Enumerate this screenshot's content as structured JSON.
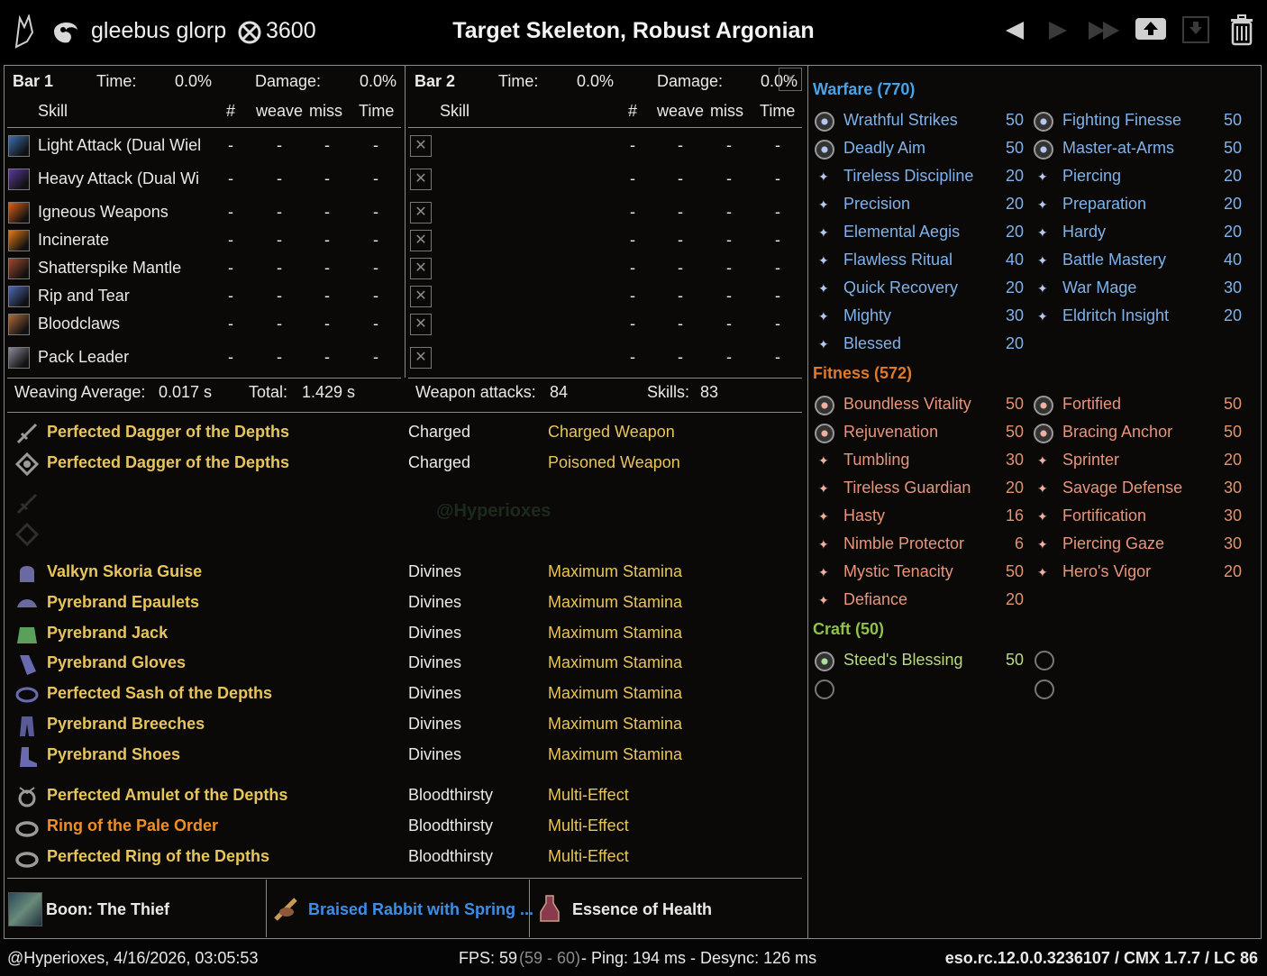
{
  "header": {
    "player_name": "gleebus glorp",
    "cp_total": "3600",
    "title": "Target Skeleton, Robust Argonian",
    "icons": [
      "class-logo-icon",
      "player-icon",
      "champion-points-icon",
      "previous-icon",
      "next-icon",
      "last-icon",
      "upload-icon",
      "save-icon",
      "delete-icon"
    ]
  },
  "bar1": {
    "label": "Bar 1",
    "time_label": "Time:",
    "time_value": "0.0%",
    "damage_label": "Damage:",
    "damage_value": "0.0%",
    "col_skill": "Skill",
    "col_count": "#",
    "col_weave": "weave",
    "col_miss": "miss",
    "col_time": "Time",
    "skills": [
      {
        "name": "Light Attack (Dual Wiel",
        "count": "-",
        "weave": "-",
        "miss": "-",
        "time": "-",
        "color": "#3a6fb0"
      },
      {
        "name": "Heavy Attack (Dual Wi",
        "count": "-",
        "weave": "-",
        "miss": "-",
        "time": "-",
        "color": "#5a3a9a"
      },
      {
        "name": "Igneous Weapons",
        "count": "-",
        "weave": "-",
        "miss": "-",
        "time": "-",
        "color": "#d8601a"
      },
      {
        "name": "Incinerate",
        "count": "-",
        "weave": "-",
        "miss": "-",
        "time": "-",
        "color": "#e07a18"
      },
      {
        "name": "Shatterspike Mantle",
        "count": "-",
        "weave": "-",
        "miss": "-",
        "time": "-",
        "color": "#a04a2a"
      },
      {
        "name": "Rip and Tear",
        "count": "-",
        "weave": "-",
        "miss": "-",
        "time": "-",
        "color": "#4a6ab0"
      },
      {
        "name": "Bloodclaws",
        "count": "-",
        "weave": "-",
        "miss": "-",
        "time": "-",
        "color": "#b06a3a"
      },
      {
        "name": "Pack Leader",
        "count": "-",
        "weave": "-",
        "miss": "-",
        "time": "-",
        "color": "#8a8a9a"
      }
    ]
  },
  "bar2": {
    "label": "Bar 2",
    "time_label": "Time:",
    "time_value": "0.0%",
    "damage_label": "Damage:",
    "damage_value": "0.0%",
    "col_skill": "Skill",
    "col_count": "#",
    "col_weave": "weave",
    "col_miss": "miss",
    "col_time": "Time",
    "empty_marker": "✕",
    "rows": [
      {
        "count": "-",
        "weave": "-",
        "miss": "-",
        "time": "-"
      },
      {
        "count": "-",
        "weave": "-",
        "miss": "-",
        "time": "-"
      },
      {
        "count": "-",
        "weave": "-",
        "miss": "-",
        "time": "-"
      },
      {
        "count": "-",
        "weave": "-",
        "miss": "-",
        "time": "-"
      },
      {
        "count": "-",
        "weave": "-",
        "miss": "-",
        "time": "-"
      },
      {
        "count": "-",
        "weave": "-",
        "miss": "-",
        "time": "-"
      },
      {
        "count": "-",
        "weave": "-",
        "miss": "-",
        "time": "-"
      },
      {
        "count": "-",
        "weave": "-",
        "miss": "-",
        "time": "-"
      }
    ]
  },
  "summary": {
    "weaving_label": "Weaving Average:",
    "weaving_value": "0.017 s",
    "total_label": "Total:",
    "total_value": "1.429 s",
    "weapon_attacks_label": "Weapon attacks:",
    "weapon_attacks_value": "84",
    "skills_label": "Skills:",
    "skills_value": "83"
  },
  "gear": {
    "weapons": [
      {
        "name": "Perfected Dagger of the Depths",
        "trait": "Charged",
        "enchant": "Charged Weapon",
        "icon": "dagger-icon"
      },
      {
        "name": "Perfected Dagger of the Depths",
        "trait": "Charged",
        "enchant": "Poisoned Weapon",
        "icon": "dagger-icon"
      }
    ],
    "armor": [
      {
        "name": "Valkyn Skoria Guise",
        "trait": "Divines",
        "enchant": "Maximum Stamina",
        "icon": "helmet-icon"
      },
      {
        "name": "Pyrebrand Epaulets",
        "trait": "Divines",
        "enchant": "Maximum Stamina",
        "icon": "shoulders-icon"
      },
      {
        "name": "Pyrebrand Jack",
        "trait": "Divines",
        "enchant": "Maximum Stamina",
        "icon": "chest-icon"
      },
      {
        "name": "Pyrebrand Gloves",
        "trait": "Divines",
        "enchant": "Maximum Stamina",
        "icon": "gloves-icon"
      },
      {
        "name": "Perfected Sash of the Depths",
        "trait": "Divines",
        "enchant": "Maximum Stamina",
        "icon": "belt-icon"
      },
      {
        "name": "Pyrebrand Breeches",
        "trait": "Divines",
        "enchant": "Maximum Stamina",
        "icon": "legs-icon"
      },
      {
        "name": "Pyrebrand Shoes",
        "trait": "Divines",
        "enchant": "Maximum Stamina",
        "icon": "boots-icon"
      }
    ],
    "jewelry": [
      {
        "name": "Perfected Amulet of the Depths",
        "trait": "Bloodthirsty",
        "enchant": "Multi-Effect",
        "icon": "amulet-icon",
        "quality": "gold"
      },
      {
        "name": "Ring of the Pale Order",
        "trait": "Bloodthirsty",
        "enchant": "Multi-Effect",
        "icon": "ring-icon",
        "quality": "orange"
      },
      {
        "name": "Perfected Ring of the Depths",
        "trait": "Bloodthirsty",
        "enchant": "Multi-Effect",
        "icon": "ring-icon",
        "quality": "gold"
      }
    ],
    "watermark": "@Hyperioxes"
  },
  "buffs": {
    "mundus": "Boon: The Thief",
    "food": "Braised Rabbit with Spring ...",
    "drink": "Essence of Health"
  },
  "cp": {
    "warfare": {
      "title": "Warfare (770)",
      "left": [
        {
          "name": "Wrathful Strikes",
          "value": "50",
          "slotted": true
        },
        {
          "name": "Deadly Aim",
          "value": "50",
          "slotted": true
        },
        {
          "name": "Tireless Discipline",
          "value": "20",
          "slotted": false
        },
        {
          "name": "Precision",
          "value": "20",
          "slotted": false
        },
        {
          "name": "Elemental Aegis",
          "value": "20",
          "slotted": false
        },
        {
          "name": "Flawless Ritual",
          "value": "40",
          "slotted": false
        },
        {
          "name": "Quick Recovery",
          "value": "20",
          "slotted": false
        },
        {
          "name": "Mighty",
          "value": "30",
          "slotted": false
        },
        {
          "name": "Blessed",
          "value": "20",
          "slotted": false
        }
      ],
      "right": [
        {
          "name": "Fighting Finesse",
          "value": "50",
          "slotted": true
        },
        {
          "name": "Master-at-Arms",
          "value": "50",
          "slotted": true
        },
        {
          "name": "Piercing",
          "value": "20",
          "slotted": false
        },
        {
          "name": "Preparation",
          "value": "20",
          "slotted": false
        },
        {
          "name": "Hardy",
          "value": "20",
          "slotted": false
        },
        {
          "name": "Battle Mastery",
          "value": "40",
          "slotted": false
        },
        {
          "name": "War Mage",
          "value": "30",
          "slotted": false
        },
        {
          "name": "Eldritch Insight",
          "value": "20",
          "slotted": false
        }
      ]
    },
    "fitness": {
      "title": "Fitness (572)",
      "left": [
        {
          "name": "Boundless Vitality",
          "value": "50",
          "slotted": true
        },
        {
          "name": "Rejuvenation",
          "value": "50",
          "slotted": true
        },
        {
          "name": "Tumbling",
          "value": "30",
          "slotted": false
        },
        {
          "name": "Tireless Guardian",
          "value": "20",
          "slotted": false
        },
        {
          "name": "Hasty",
          "value": "16",
          "slotted": false
        },
        {
          "name": "Nimble Protector",
          "value": "6",
          "slotted": false
        },
        {
          "name": "Mystic Tenacity",
          "value": "50",
          "slotted": false
        },
        {
          "name": "Defiance",
          "value": "20",
          "slotted": false
        }
      ],
      "right": [
        {
          "name": "Fortified",
          "value": "50",
          "slotted": true
        },
        {
          "name": "Bracing Anchor",
          "value": "50",
          "slotted": true
        },
        {
          "name": "Sprinter",
          "value": "20",
          "slotted": false
        },
        {
          "name": "Savage Defense",
          "value": "30",
          "slotted": false
        },
        {
          "name": "Fortification",
          "value": "30",
          "slotted": false
        },
        {
          "name": "Piercing Gaze",
          "value": "30",
          "slotted": false
        },
        {
          "name": "Hero's Vigor",
          "value": "20",
          "slotted": false
        }
      ]
    },
    "craft": {
      "title": "Craft (50)",
      "left": [
        {
          "name": "Steed's Blessing",
          "value": "50",
          "slotted": true
        }
      ]
    }
  },
  "footer": {
    "author_time": "@Hyperioxes, 4/16/2026, 03:05:53",
    "fps_label": "FPS: 59",
    "fps_range": "(59 - 60)",
    "ping": "- Ping: 194 ms - Desync: 126 ms",
    "version": "eso.rc.12.0.0.3236107 / CMX 1.7.7 / LC 86"
  },
  "colors": {
    "gold": "#e8c55a",
    "orange": "#ee8f2a",
    "warfare": "#4aa3e6",
    "fitness": "#e07a2a",
    "craft": "#8ec24a",
    "food": "#3b8fe8"
  }
}
